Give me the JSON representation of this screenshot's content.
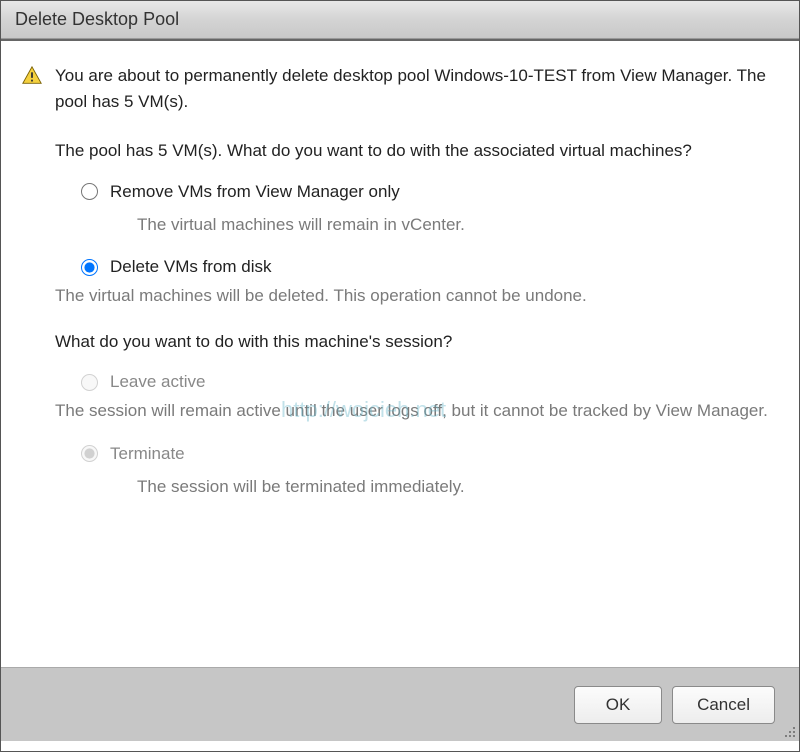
{
  "titlebar": {
    "title": "Delete Desktop Pool"
  },
  "warning": {
    "text": "You are about to permanently delete desktop pool Windows-10-TEST from View Manager. The pool has 5 VM(s)."
  },
  "vm_question": {
    "text": "The pool has 5 VM(s). What do you want to do with the associated virtual machines?",
    "option_remove": {
      "label": "Remove VMs from View Manager only",
      "description": "The virtual machines will remain in vCenter."
    },
    "option_delete": {
      "label": "Delete VMs from disk",
      "description": "The virtual machines will be deleted. This operation cannot be undone."
    }
  },
  "session_question": {
    "text": "What do you want to do with this machine's session?",
    "option_leave": {
      "label": "Leave active",
      "description": "The session will remain active until the user logs off, but it cannot be tracked by View Manager."
    },
    "option_terminate": {
      "label": "Terminate",
      "description": "The session will be terminated immediately."
    }
  },
  "buttons": {
    "ok": "OK",
    "cancel": "Cancel"
  },
  "watermark": "http://wojcieh.net"
}
